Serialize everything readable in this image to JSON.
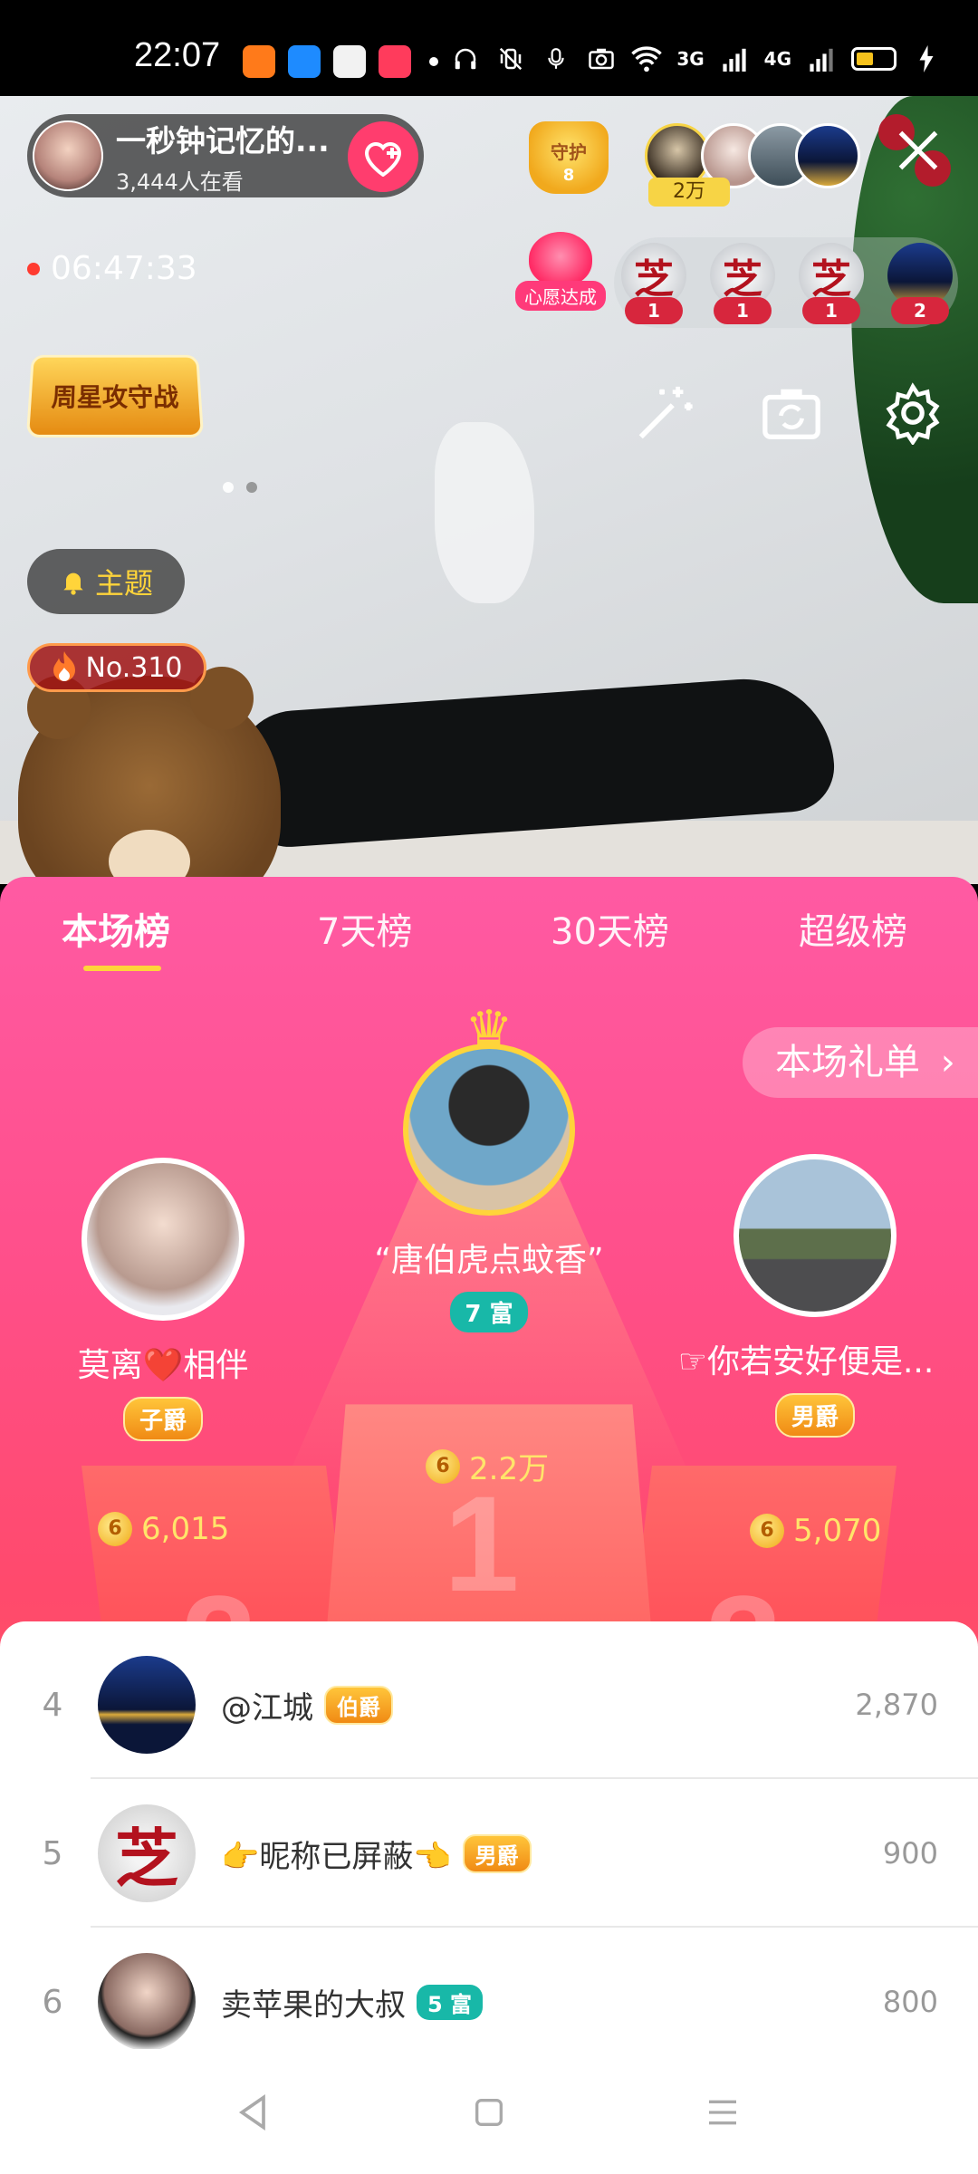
{
  "status_bar": {
    "time": "22:07",
    "network_3g": "3G",
    "network_4g": "4G"
  },
  "host": {
    "name": "一秒钟记忆的...",
    "viewers": "3,444人在看"
  },
  "guard": {
    "label": "守护",
    "level": "8"
  },
  "top_viewer_badge": "2万",
  "live_timer": "06:47:33",
  "wish": {
    "label": "心愿达成"
  },
  "gift_counts": [
    "1",
    "1",
    "1",
    "2"
  ],
  "weekstar_label": "周星攻守战",
  "topic_button": "主题",
  "rank_badge": "No.310",
  "tabs": [
    {
      "label": "本场榜",
      "active": true
    },
    {
      "label": "7天榜",
      "active": false
    },
    {
      "label": "30天榜",
      "active": false
    },
    {
      "label": "超级榜",
      "active": false
    }
  ],
  "gift_list_button": "本场礼单",
  "podium": {
    "first": {
      "name": "“唐伯虎点蚊香”",
      "badge": "7 富",
      "score": "2.2万",
      "rank_digit": "1"
    },
    "second": {
      "name": "莫离❤️相伴",
      "badge": "子爵",
      "score": "6,015",
      "rank_digit": "2"
    },
    "third": {
      "name": "☞你若安好便是...",
      "badge": "男爵",
      "score": "5,070",
      "rank_digit": "3"
    }
  },
  "coin_glyph": "6",
  "ranking_list": [
    {
      "rank": "4",
      "name": "@江城",
      "badge": "伯爵",
      "badge_style": "gold",
      "score": "2,870"
    },
    {
      "rank": "5",
      "name": "👉昵称已屏蔽👈",
      "badge": "男爵",
      "badge_style": "gold",
      "score": "900"
    },
    {
      "rank": "6",
      "name": "卖苹果的大叔",
      "badge": "5 富",
      "badge_style": "teal",
      "score": "800"
    }
  ],
  "colors": {
    "panel_top": "#ff5aa3",
    "panel_bottom": "#ff5560",
    "accent_yellow": "#ffd43a",
    "fortune_teal": "#18b8a8",
    "follow_pink": "#ff3d6e"
  }
}
